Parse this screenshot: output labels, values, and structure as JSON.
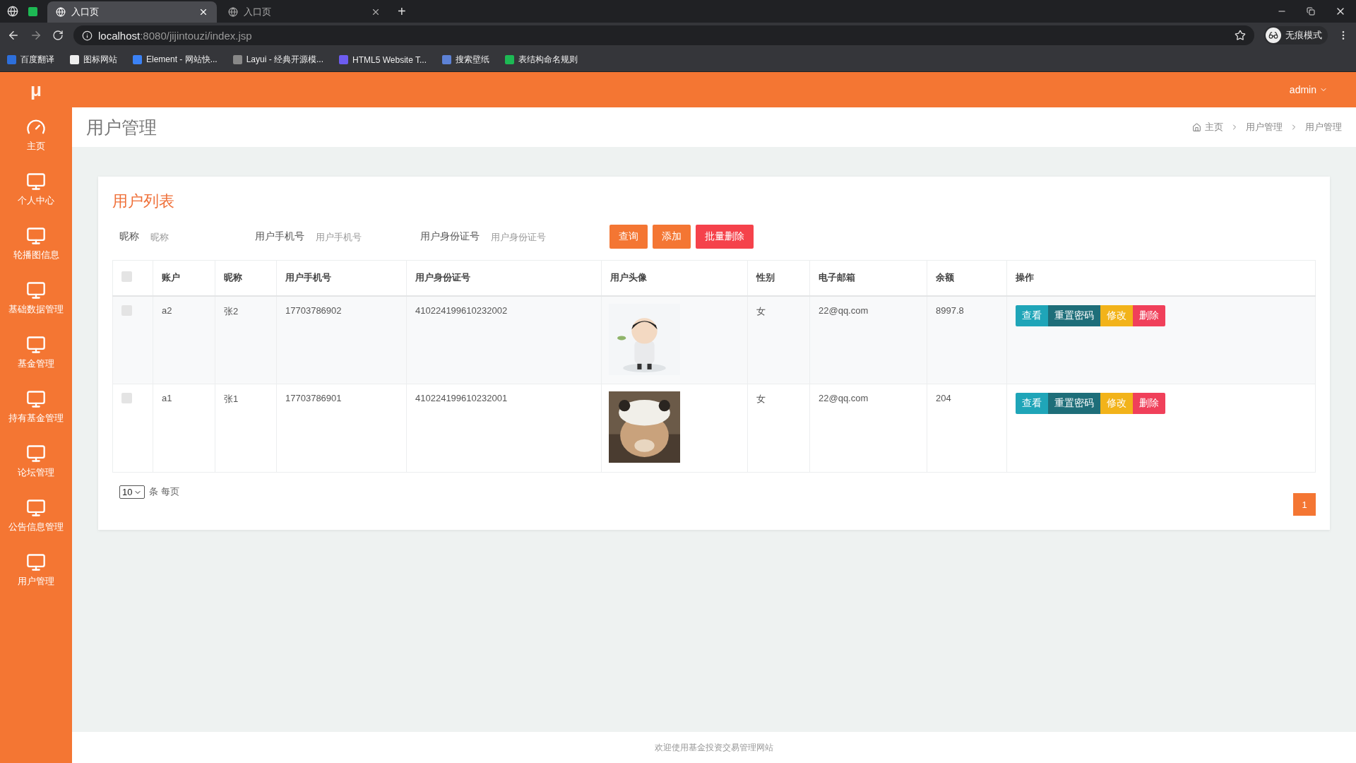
{
  "browser": {
    "tabs": [
      {
        "title": "入口页",
        "selected": true
      },
      {
        "title": "入口页",
        "selected": false
      }
    ],
    "new_tab": "+",
    "url_host": "localhost",
    "url_path": ":8080/jijintouzi/index.jsp",
    "profile": "无痕模式",
    "bookmarks": [
      "百度翻译",
      "图标网站",
      "Element - 网站快...",
      "Layui - 经典开源模...",
      "HTML5 Website T...",
      "搜索壁纸",
      "表结构命名规则"
    ]
  },
  "header": {
    "logo": "μ",
    "user": "admin"
  },
  "sidebar": {
    "items": [
      {
        "label": "主页",
        "kind": "dashboard"
      },
      {
        "label": "个人中心",
        "kind": "monitor"
      },
      {
        "label": "轮播图信息",
        "kind": "monitor"
      },
      {
        "label": "基础数据管理",
        "kind": "monitor"
      },
      {
        "label": "基金管理",
        "kind": "monitor"
      },
      {
        "label": "持有基金管理",
        "kind": "monitor"
      },
      {
        "label": "论坛管理",
        "kind": "monitor"
      },
      {
        "label": "公告信息管理",
        "kind": "monitor"
      },
      {
        "label": "用户管理",
        "kind": "monitor"
      }
    ]
  },
  "page": {
    "title": "用户管理",
    "breadcrumb": [
      "主页",
      "用户管理",
      "用户管理"
    ]
  },
  "card": {
    "title": "用户列表",
    "filters": [
      {
        "label": "昵称",
        "placeholder": "昵称"
      },
      {
        "label": "用户手机号",
        "placeholder": "用户手机号"
      },
      {
        "label": "用户身份证号",
        "placeholder": "用户身份证号"
      }
    ],
    "actions": [
      {
        "label": "查询",
        "kind": "primary"
      },
      {
        "label": "添加",
        "kind": "primary"
      },
      {
        "label": "批量删除",
        "kind": "danger"
      }
    ],
    "table": {
      "select_all_checked": false,
      "columns": [
        "账户",
        "昵称",
        "用户手机号",
        "用户身份证号",
        "用户头像",
        "性别",
        "电子邮箱",
        "余额",
        "操作"
      ],
      "rows": [
        {
          "checked": false,
          "account": "a2",
          "nickname": "张2",
          "phone": "17703786902",
          "id_number": "410224199610232002",
          "gender": "女",
          "email": "22@qq.com",
          "balance": "8997.8",
          "buttons": [
            {
              "label": "查看",
              "kind": "info"
            },
            {
              "label": "重置密码",
              "kind": "dark"
            },
            {
              "label": "修改",
              "kind": "warning"
            },
            {
              "label": "删除",
              "kind": "danger"
            }
          ]
        },
        {
          "checked": false,
          "account": "a1",
          "nickname": "张1",
          "phone": "17703786901",
          "id_number": "410224199610232001",
          "gender": "女",
          "email": "22@qq.com",
          "balance": "204",
          "buttons": [
            {
              "label": "查看",
              "kind": "info"
            },
            {
              "label": "重置密码",
              "kind": "dark"
            },
            {
              "label": "修改",
              "kind": "warning"
            },
            {
              "label": "删除",
              "kind": "danger"
            }
          ]
        }
      ]
    },
    "page_size": "10",
    "page_size_label": "条 每页",
    "pages": [
      {
        "label": "1",
        "selected": true
      }
    ]
  },
  "footer": "欢迎使用基金投资交易管理网站"
}
